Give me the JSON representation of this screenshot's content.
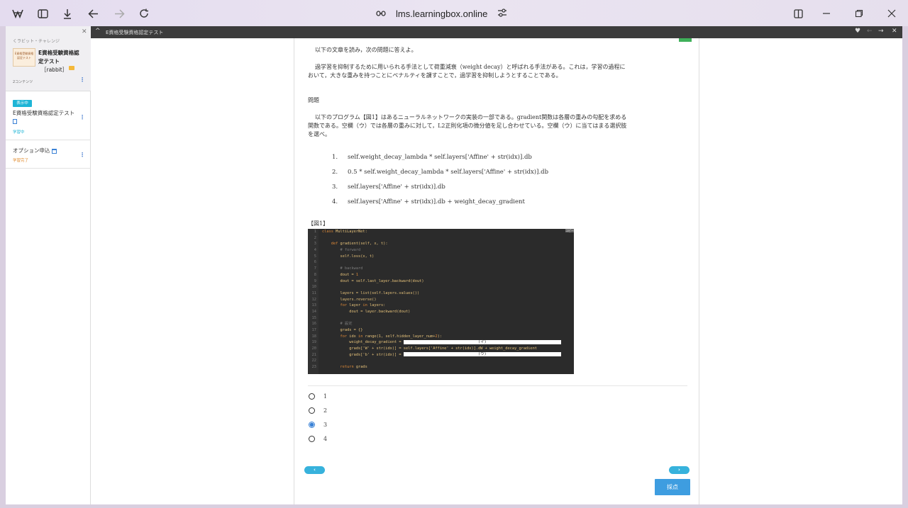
{
  "browser": {
    "url": "lms.learningbox.online",
    "icons": [
      "browser-logo-icon",
      "sidebar-toggle-icon",
      "download-icon",
      "back-icon",
      "forward-icon",
      "reload-icon",
      "site-info-icon",
      "site-settings-icon",
      "split-view-icon",
      "minimize-icon",
      "maximize-icon",
      "close-icon"
    ]
  },
  "topbar": {
    "title": "E資格受験資格認定テスト"
  },
  "sidebar": {
    "breadcrumb": "くラビット・チャレンジ",
    "thumbnail_text": "E資格受験資格認定テスト",
    "course_title": "E資格受験資格認定テスト",
    "course_sub": "［rabbit］",
    "count": "2コンテンツ",
    "items": [
      {
        "badge": "表示中",
        "title": "E資格受験資格認定テスト",
        "status": "学習中",
        "status_color": "#1fb5d6"
      },
      {
        "badge": "",
        "title": "オプション申込",
        "status": "学習完了",
        "status_color": "#e08a2c"
      }
    ]
  },
  "question": {
    "intro": "以下の文章を読み，次の問題に答えよ。",
    "passage": "過学習を抑制するために用いられる手法として荷重減衰（weight decay）と呼ばれる手法がある。これは，学習の過程において，大きな重みを持つことにペナルティを課すことで，過学習を抑制しようとすることである。",
    "heading": "問題",
    "body": "以下のプログラム【図1】はあるニューラルネットワークの実装の一部である。gradient関数は各層の重みの勾配を求める関数である。空欄（ウ）では各層の重みに対して，L2正則化項の微分値を足し合わせている。空欄（ウ）に当てはまる選択肢を選べ。",
    "choices": [
      {
        "num": "1.",
        "text": "self.weight_decay_lambda * self.layers['Affine' + str(idx)].db"
      },
      {
        "num": "2.",
        "text": "0.5 * self.weight_decay_lambda * self.layers['Affine' + str(idx)].db"
      },
      {
        "num": "3.",
        "text": "self.layers['Affine' + str(idx)].db"
      },
      {
        "num": "4.",
        "text": "self.layers['Affine' + str(idx)].db + weight_decay_gradient"
      }
    ],
    "figure_label": "【図1】"
  },
  "code": {
    "line_numbers": [
      "1",
      "2",
      "3",
      "4",
      "5",
      "6",
      "7",
      "8",
      "9",
      "10",
      "11",
      "12",
      "13",
      "14",
      "15",
      "16",
      "17",
      "18",
      "19",
      "20",
      "21",
      "22",
      "23"
    ],
    "corner": "コピー",
    "blank_i": "(イ)",
    "blank_u": "(ウ)"
  },
  "answers": {
    "options": [
      "1",
      "2",
      "3",
      "4"
    ],
    "selected_index": 2
  },
  "buttons": {
    "prev": "‹",
    "next": "›",
    "submit": "採点"
  }
}
